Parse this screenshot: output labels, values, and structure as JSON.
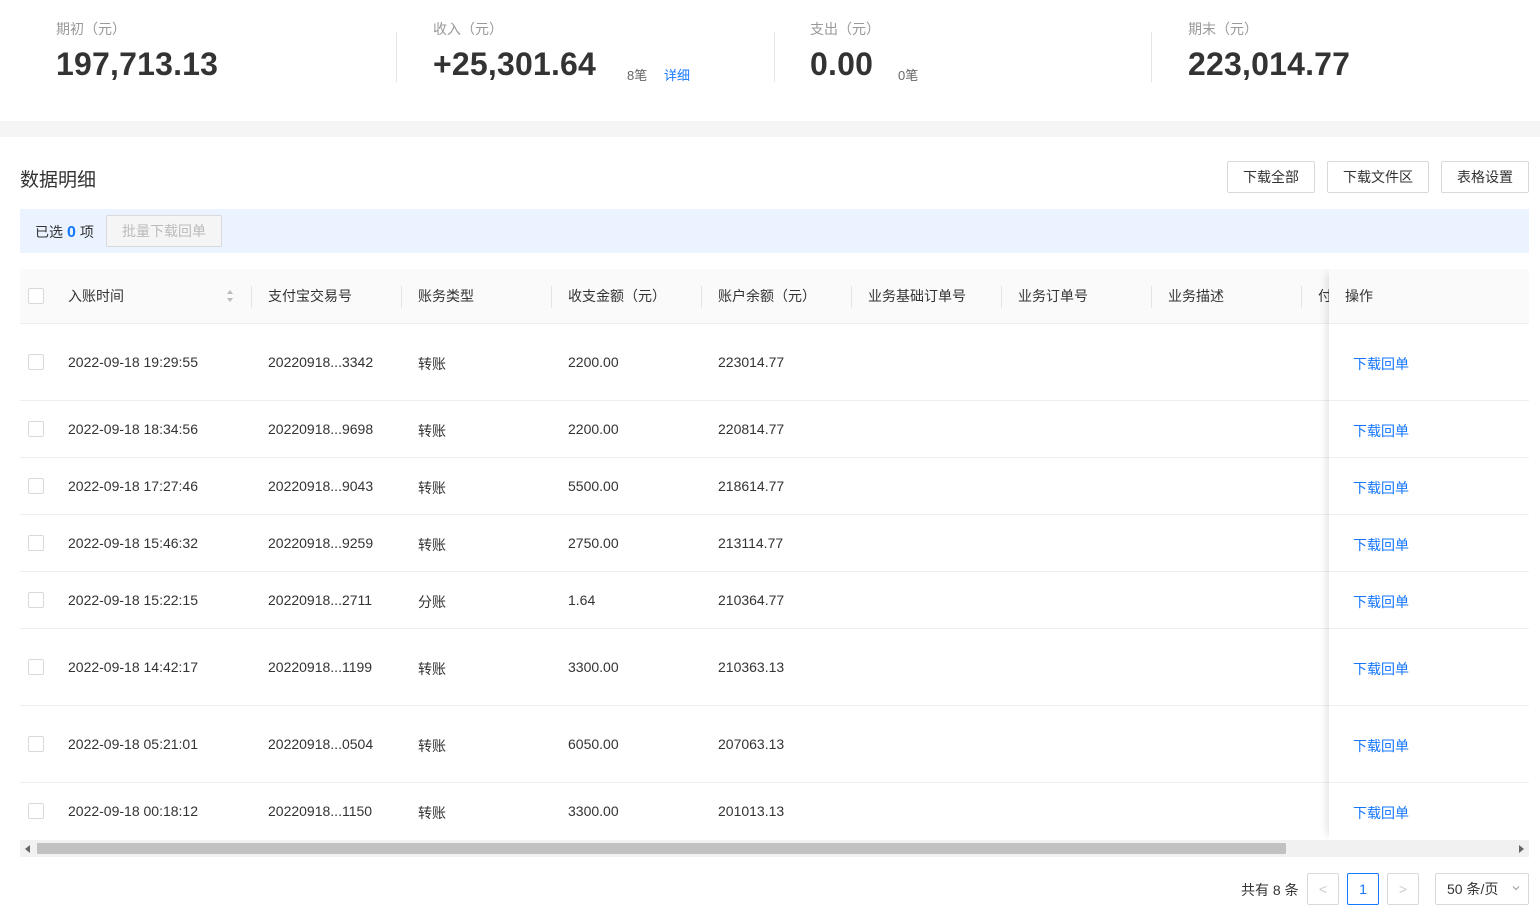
{
  "summary": {
    "opening": {
      "label": "期初（元）",
      "value": "197,713.13"
    },
    "income": {
      "label": "收入（元）",
      "value": "+25,301.64",
      "count": "8笔",
      "detail_link": "详细"
    },
    "expense": {
      "label": "支出（元）",
      "value": "0.00",
      "count": "0笔"
    },
    "closing": {
      "label": "期末（元）",
      "value": "223,014.77"
    }
  },
  "section": {
    "title": "数据明细",
    "buttons": {
      "download_all": "下载全部",
      "download_area": "下载文件区",
      "table_settings": "表格设置"
    }
  },
  "selection": {
    "prefix": "已选",
    "count": "0",
    "suffix": "项",
    "batch_button": "批量下载回单"
  },
  "table": {
    "columns": {
      "time": "入账时间",
      "trade_no": "支付宝交易号",
      "type": "账务类型",
      "amount": "收支金额（元）",
      "balance": "账户余额（元）",
      "base_order": "业务基础订单号",
      "order": "业务订单号",
      "desc": "业务描述",
      "pay_partial": "付",
      "action": "操作"
    },
    "rows": [
      {
        "time": "2022-09-18 19:29:55",
        "trade_no": "20220918...3342",
        "type": "转账",
        "amount": "2200.00",
        "balance": "223014.77",
        "action": "下载回单"
      },
      {
        "time": "2022-09-18 18:34:56",
        "trade_no": "20220918...9698",
        "type": "转账",
        "amount": "2200.00",
        "balance": "220814.77",
        "action": "下载回单"
      },
      {
        "time": "2022-09-18 17:27:46",
        "trade_no": "20220918...9043",
        "type": "转账",
        "amount": "5500.00",
        "balance": "218614.77",
        "action": "下载回单"
      },
      {
        "time": "2022-09-18 15:46:32",
        "trade_no": "20220918...9259",
        "type": "转账",
        "amount": "2750.00",
        "balance": "213114.77",
        "action": "下载回单"
      },
      {
        "time": "2022-09-18 15:22:15",
        "trade_no": "20220918...2711",
        "type": "分账",
        "amount": "1.64",
        "balance": "210364.77",
        "action": "下载回单"
      },
      {
        "time": "2022-09-18 14:42:17",
        "trade_no": "20220918...1199",
        "type": "转账",
        "amount": "3300.00",
        "balance": "210363.13",
        "action": "下载回单"
      },
      {
        "time": "2022-09-18 05:21:01",
        "trade_no": "20220918...0504",
        "type": "转账",
        "amount": "6050.00",
        "balance": "207063.13",
        "action": "下载回单"
      },
      {
        "time": "2022-09-18 00:18:12",
        "trade_no": "20220918...1150",
        "type": "转账",
        "amount": "3300.00",
        "balance": "201013.13",
        "action": "下载回单"
      }
    ]
  },
  "pagination": {
    "total": "共有 8 条",
    "prev": "<",
    "current_page": "1",
    "next": ">",
    "page_size": "50 条/页"
  },
  "colors": {
    "accent": "#1677ff",
    "select_bar": "#eaf3ff"
  }
}
